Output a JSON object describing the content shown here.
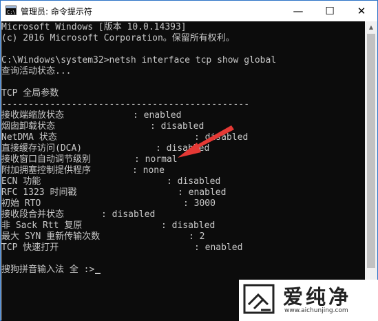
{
  "window": {
    "title": "管理员: 命令提示符",
    "icon": "cmd-console-icon",
    "controls": {
      "minimize": "—",
      "maximize": "☐",
      "close": "✕"
    }
  },
  "console": {
    "lines": [
      "Microsoft Windows [版本 10.0.14393]",
      "(c) 2016 Microsoft Corporation。保留所有权利。",
      "",
      "C:\\Windows\\system32>netsh interface tcp show global",
      "查询活动状态...",
      "",
      "TCP 全局参数",
      "----------------------------------------------",
      "",
      "",
      "",
      "",
      "",
      "",
      "",
      "",
      "",
      "",
      "",
      "",
      "",
      "",
      "",
      "",
      "",
      "搜狗拼音输入法 全 :>"
    ],
    "params": [
      {
        "label": "接收端缩放状态",
        "value": ": enabled"
      },
      {
        "label": "烟囱卸载状态",
        "value": ": disabled"
      },
      {
        "label": "NetDMA 状态",
        "value": ": disabled"
      },
      {
        "label": "直接缓存访问(DCA)",
        "value": ": disabled"
      },
      {
        "label": "接收窗口自动调节级别",
        "value": ": normal"
      },
      {
        "label": "附加拥塞控制提供程序",
        "value": ": none"
      },
      {
        "label": "ECN 功能",
        "value": ": disabled"
      },
      {
        "label": "RFC 1323 时间戳",
        "value": ": enabled"
      },
      {
        "label": "初始 RTO",
        "value": ": 3000"
      },
      {
        "label": "接收段合并状态",
        "value": ": disabled"
      },
      {
        "label": "非 Sack Rtt 复原",
        "value": ": disabled"
      },
      {
        "label": "最大 SYN 重新传输次数",
        "value": ": 2"
      },
      {
        "label": "TCP 快速打开",
        "value": ": enabled"
      }
    ]
  },
  "watermark": {
    "text": "爱纯净",
    "url": "www.aichunjing.com"
  },
  "colors": {
    "console_bg": "#0c0c0c",
    "console_text": "#c8c8c8",
    "annotation_arrow": "#e53935"
  }
}
